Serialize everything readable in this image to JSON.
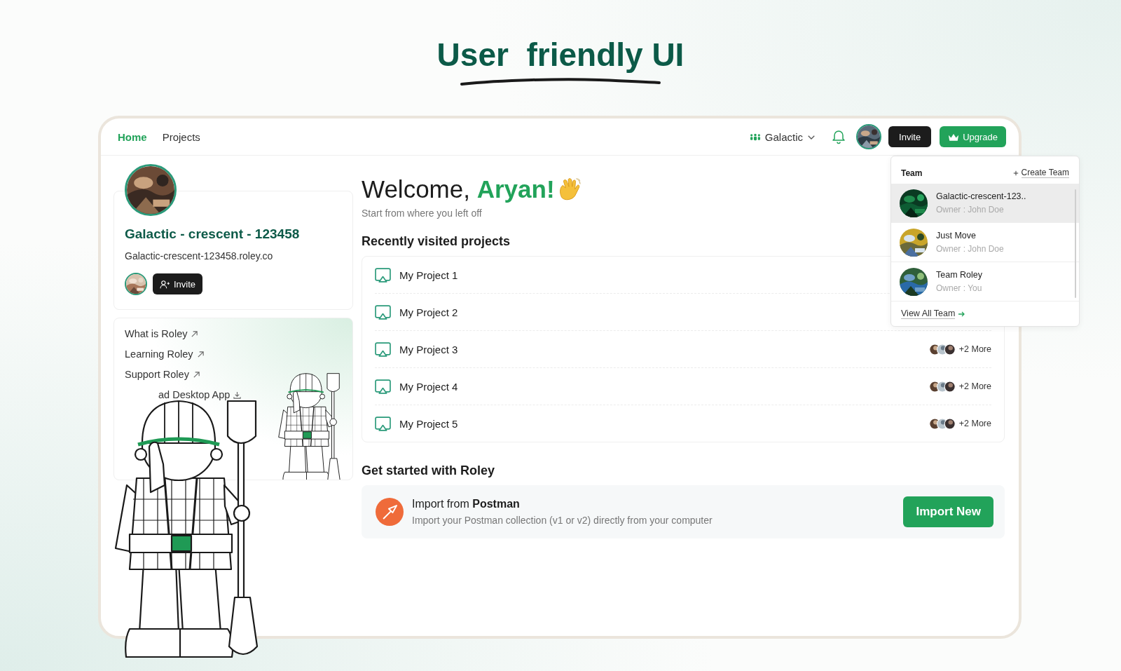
{
  "heading": "User  friendly UI",
  "nav": {
    "tabs": [
      {
        "label": "Home",
        "selected": true
      },
      {
        "label": "Projects",
        "selected": false
      }
    ],
    "workspace": "Galactic",
    "invite": "Invite",
    "upgrade": "Upgrade"
  },
  "workspace_card": {
    "name": "Galactic - crescent - 123458",
    "domain": "Galactic-crescent-123458.roley.co",
    "invite": "Invite"
  },
  "links": [
    {
      "label": "What is Roley",
      "kind": "external"
    },
    {
      "label": "Learning Roley",
      "kind": "external"
    },
    {
      "label": "Support Roley",
      "kind": "external"
    },
    {
      "label": "ad Desktop App",
      "kind": "download"
    }
  ],
  "welcome": {
    "greeting": "Welcome,",
    "name": "Aryan!",
    "subtitle": "Start from where you left off"
  },
  "recent": {
    "title": "Recently visited projects",
    "projects": [
      {
        "name": "My Project 1"
      },
      {
        "name": "My Project 2"
      },
      {
        "name": "My Project 3",
        "more": "+2 More"
      },
      {
        "name": "My Project 4",
        "more": "+2 More"
      },
      {
        "name": "My Project 5",
        "more": "+2 More"
      }
    ]
  },
  "get_started": {
    "title": "Get started with Roley",
    "import": {
      "title": "Import from **Postman**",
      "description": "Import your Postman collection (v1 or v2) directly from your computer",
      "button": "Import New"
    }
  },
  "team_menu": {
    "title": "Team",
    "create": "Create Team",
    "teams": [
      {
        "name": "Galactic-crescent-123..",
        "owner": "Owner : John Doe",
        "selected": true
      },
      {
        "name": "Just Move",
        "owner": "Owner : John Doe",
        "selected": false
      },
      {
        "name": "Team Roley",
        "owner": "Owner : You",
        "selected": false
      }
    ],
    "view_all": "View All Team"
  }
}
